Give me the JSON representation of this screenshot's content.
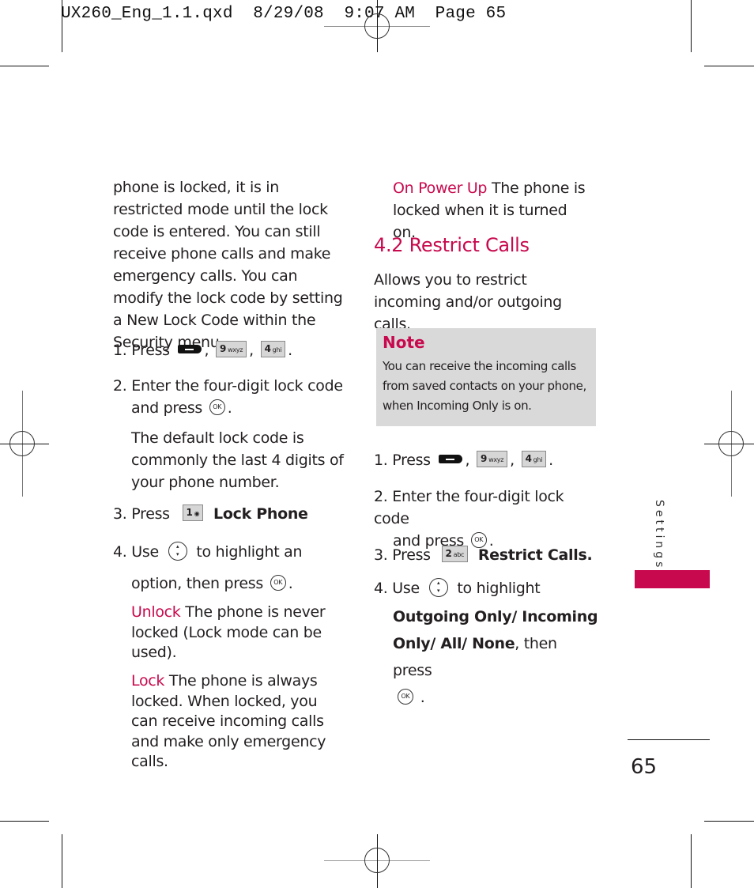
{
  "slug": "UX260_Eng_1.1.qxd  8/29/08  9:07 AM  Page 65",
  "left_column": {
    "intro": "phone is locked, it is in restricted mode until the lock code is entered. You can still receive phone calls and make emergency calls. You can modify the lock code by setting a New Lock Code within the Security menu.",
    "step1": {
      "num": "1.",
      "text": "Press",
      "keys": [
        {
          "main": "9",
          "sub": "wxyz"
        },
        {
          "main": "4",
          "sub": "ghi"
        }
      ]
    },
    "step2": {
      "num": "2.",
      "text": "Enter the four-digit lock code",
      "text2": "and press",
      "ok": "OK"
    },
    "default_note": "The default lock code is commonly the last 4 digits of your phone number.",
    "step3": {
      "num": "3.",
      "text": "Press",
      "key": {
        "main": "1",
        "sub": "voicemail"
      },
      "action": "Lock Phone"
    },
    "step4": {
      "num": "4.",
      "text": "Use",
      "text_b": "to highlight an",
      "text2": "option, then press",
      "ok": "OK"
    },
    "options": [
      {
        "label": "Unlock",
        "desc": "The phone is never locked (Lock mode can be used)."
      },
      {
        "label": "Lock",
        "desc": "The phone is always locked. When locked, you can receive incoming calls and make only emergency calls."
      }
    ]
  },
  "right_column": {
    "option_power": {
      "label": "On Power Up",
      "desc": "The phone is locked when it is turned on."
    },
    "section_title": "4.2 Restrict Calls",
    "section_desc": "Allows you to restrict incoming and/or outgoing calls.",
    "note": {
      "title": "Note",
      "text": "You can receive the incoming calls from saved contacts on your phone, when Incoming Only is on."
    },
    "step1": {
      "num": "1.",
      "text": "Press",
      "keys": [
        {
          "main": "9",
          "sub": "wxyz"
        },
        {
          "main": "4",
          "sub": "ghi"
        }
      ]
    },
    "step2": {
      "num": "2.",
      "text": "Enter the four-digit lock code",
      "text2": "and press",
      "ok": "OK"
    },
    "step3": {
      "num": "3.",
      "text": "Press",
      "key": {
        "main": "2",
        "sub": "abc"
      },
      "action": "Restrict Calls."
    },
    "step4": {
      "num": "4.",
      "text": "Use",
      "text_b": "to highlight",
      "options_bold": "Outgoing Only/ Incoming Only/ All/ None",
      "text2": ", then press",
      "ok": "OK"
    }
  },
  "sidebar": {
    "section_label": "Settings",
    "accent_color": "#c8094d"
  },
  "page_number": "65"
}
